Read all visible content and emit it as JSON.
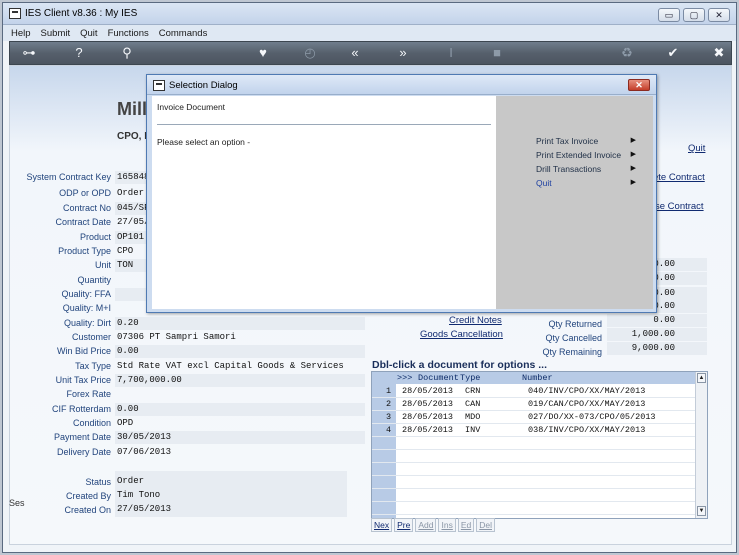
{
  "window": {
    "title": "IES Client v8.36 : My IES",
    "min": "▭",
    "max": "▢",
    "close": "✕"
  },
  "menu": [
    "Help",
    "Submit",
    "Quit",
    "Functions",
    "Commands"
  ],
  "toolbar": [
    "key-icon",
    "help-icon",
    "search-icon",
    "heart-icon",
    "clock-icon",
    "rewind-icon",
    "forward-icon",
    "text-cursor-icon",
    "stop-icon",
    "recycle-icon",
    "check-icon",
    "close-icon"
  ],
  "page": {
    "heading": "Mill",
    "sub": "CPO, I"
  },
  "fields": [
    {
      "label": "System Contract Key",
      "value": "165848"
    },
    {
      "label": "ODP or OPD",
      "value": "Order."
    },
    {
      "label": "Contract No",
      "value": "045/SF"
    },
    {
      "label": "Contract Date",
      "value": "27/05/"
    },
    {
      "label": "Product",
      "value": "OP101"
    },
    {
      "label": "Product Type",
      "value": "CPO"
    },
    {
      "label": "Unit",
      "value": "TON"
    },
    {
      "label": "Quantity",
      "value": ""
    },
    {
      "label": "Quality: FFA",
      "value": ""
    },
    {
      "label": "Quality: M+I",
      "value": ""
    },
    {
      "label": "Quality: Dirt",
      "value": "       0.20"
    },
    {
      "label": "Customer",
      "value": "07306 PT Sampri Samori"
    },
    {
      "label": "Win Bid Price",
      "value": "       0.00"
    },
    {
      "label": "Tax Type",
      "value": "Std Rate VAT excl Capital Goods & Services"
    },
    {
      "label": "Unit Tax Price",
      "value": " 7,700,000.00"
    },
    {
      "label": "Forex Rate",
      "value": ""
    },
    {
      "label": "CIF Rotterdam",
      "value": "       0.00"
    },
    {
      "label": "Condition",
      "value": "OPD"
    },
    {
      "label": "Payment Date",
      "value": "30/05/2013"
    },
    {
      "label": "Delivery Date",
      "value": "07/06/2013"
    }
  ],
  "status_fields": [
    {
      "label": "Status",
      "value": "Order"
    },
    {
      "label": "Created By",
      "value": "Tim Tono"
    },
    {
      "label": "Created On",
      "value": "27/05/2013"
    }
  ],
  "links": {
    "quit": "Quit",
    "delete_contract": "ete Contract",
    "close_contract": "se Contract",
    "credit_notes": "Credit Notes",
    "goods_cancellation": "Goods Cancellation"
  },
  "qty_panel": [
    {
      "label": "",
      "value": "0.00"
    },
    {
      "label": "",
      "value": "0.00"
    },
    {
      "label": "",
      "value": "0.00"
    },
    {
      "label": "",
      "value": "0.00"
    },
    {
      "label": "Qty Returned",
      "value": "0.00"
    },
    {
      "label": "Qty Cancelled",
      "value": "1,000.00"
    },
    {
      "label": "Qty Remaining",
      "value": "9,000.00"
    }
  ],
  "documents": {
    "title": "Dbl-click a document for options ...",
    "headers": {
      "marker": ">>>",
      "document": "Document",
      "type": "Type",
      "number": "Number"
    },
    "rows": [
      {
        "n": "1",
        "date": "28/05/2013",
        "type": "CRN",
        "number": "040/INV/CPO/XX/MAY/2013"
      },
      {
        "n": "2",
        "date": "28/05/2013",
        "type": "CAN",
        "number": "019/CAN/CPO/XX/MAY/2013"
      },
      {
        "n": "3",
        "date": "28/05/2013",
        "type": "MDO",
        "number": "027/DO/XX-073/CPO/05/2013"
      },
      {
        "n": "4",
        "date": "28/05/2013",
        "type": "INV",
        "number": "038/INV/CPO/XX/MAY/2013"
      }
    ],
    "nav": [
      "Nex",
      "Pre",
      "Add",
      "Ins",
      "Ed",
      "Del"
    ]
  },
  "dialog": {
    "title": "Selection Dialog",
    "document": "Invoice Document",
    "prompt": "Please select an option -",
    "options": [
      "Print Tax Invoice",
      "Print Extended Invoice",
      "Drill Transactions",
      "Quit"
    ],
    "close": "✕"
  },
  "edge": {
    "ses": "Ses"
  }
}
